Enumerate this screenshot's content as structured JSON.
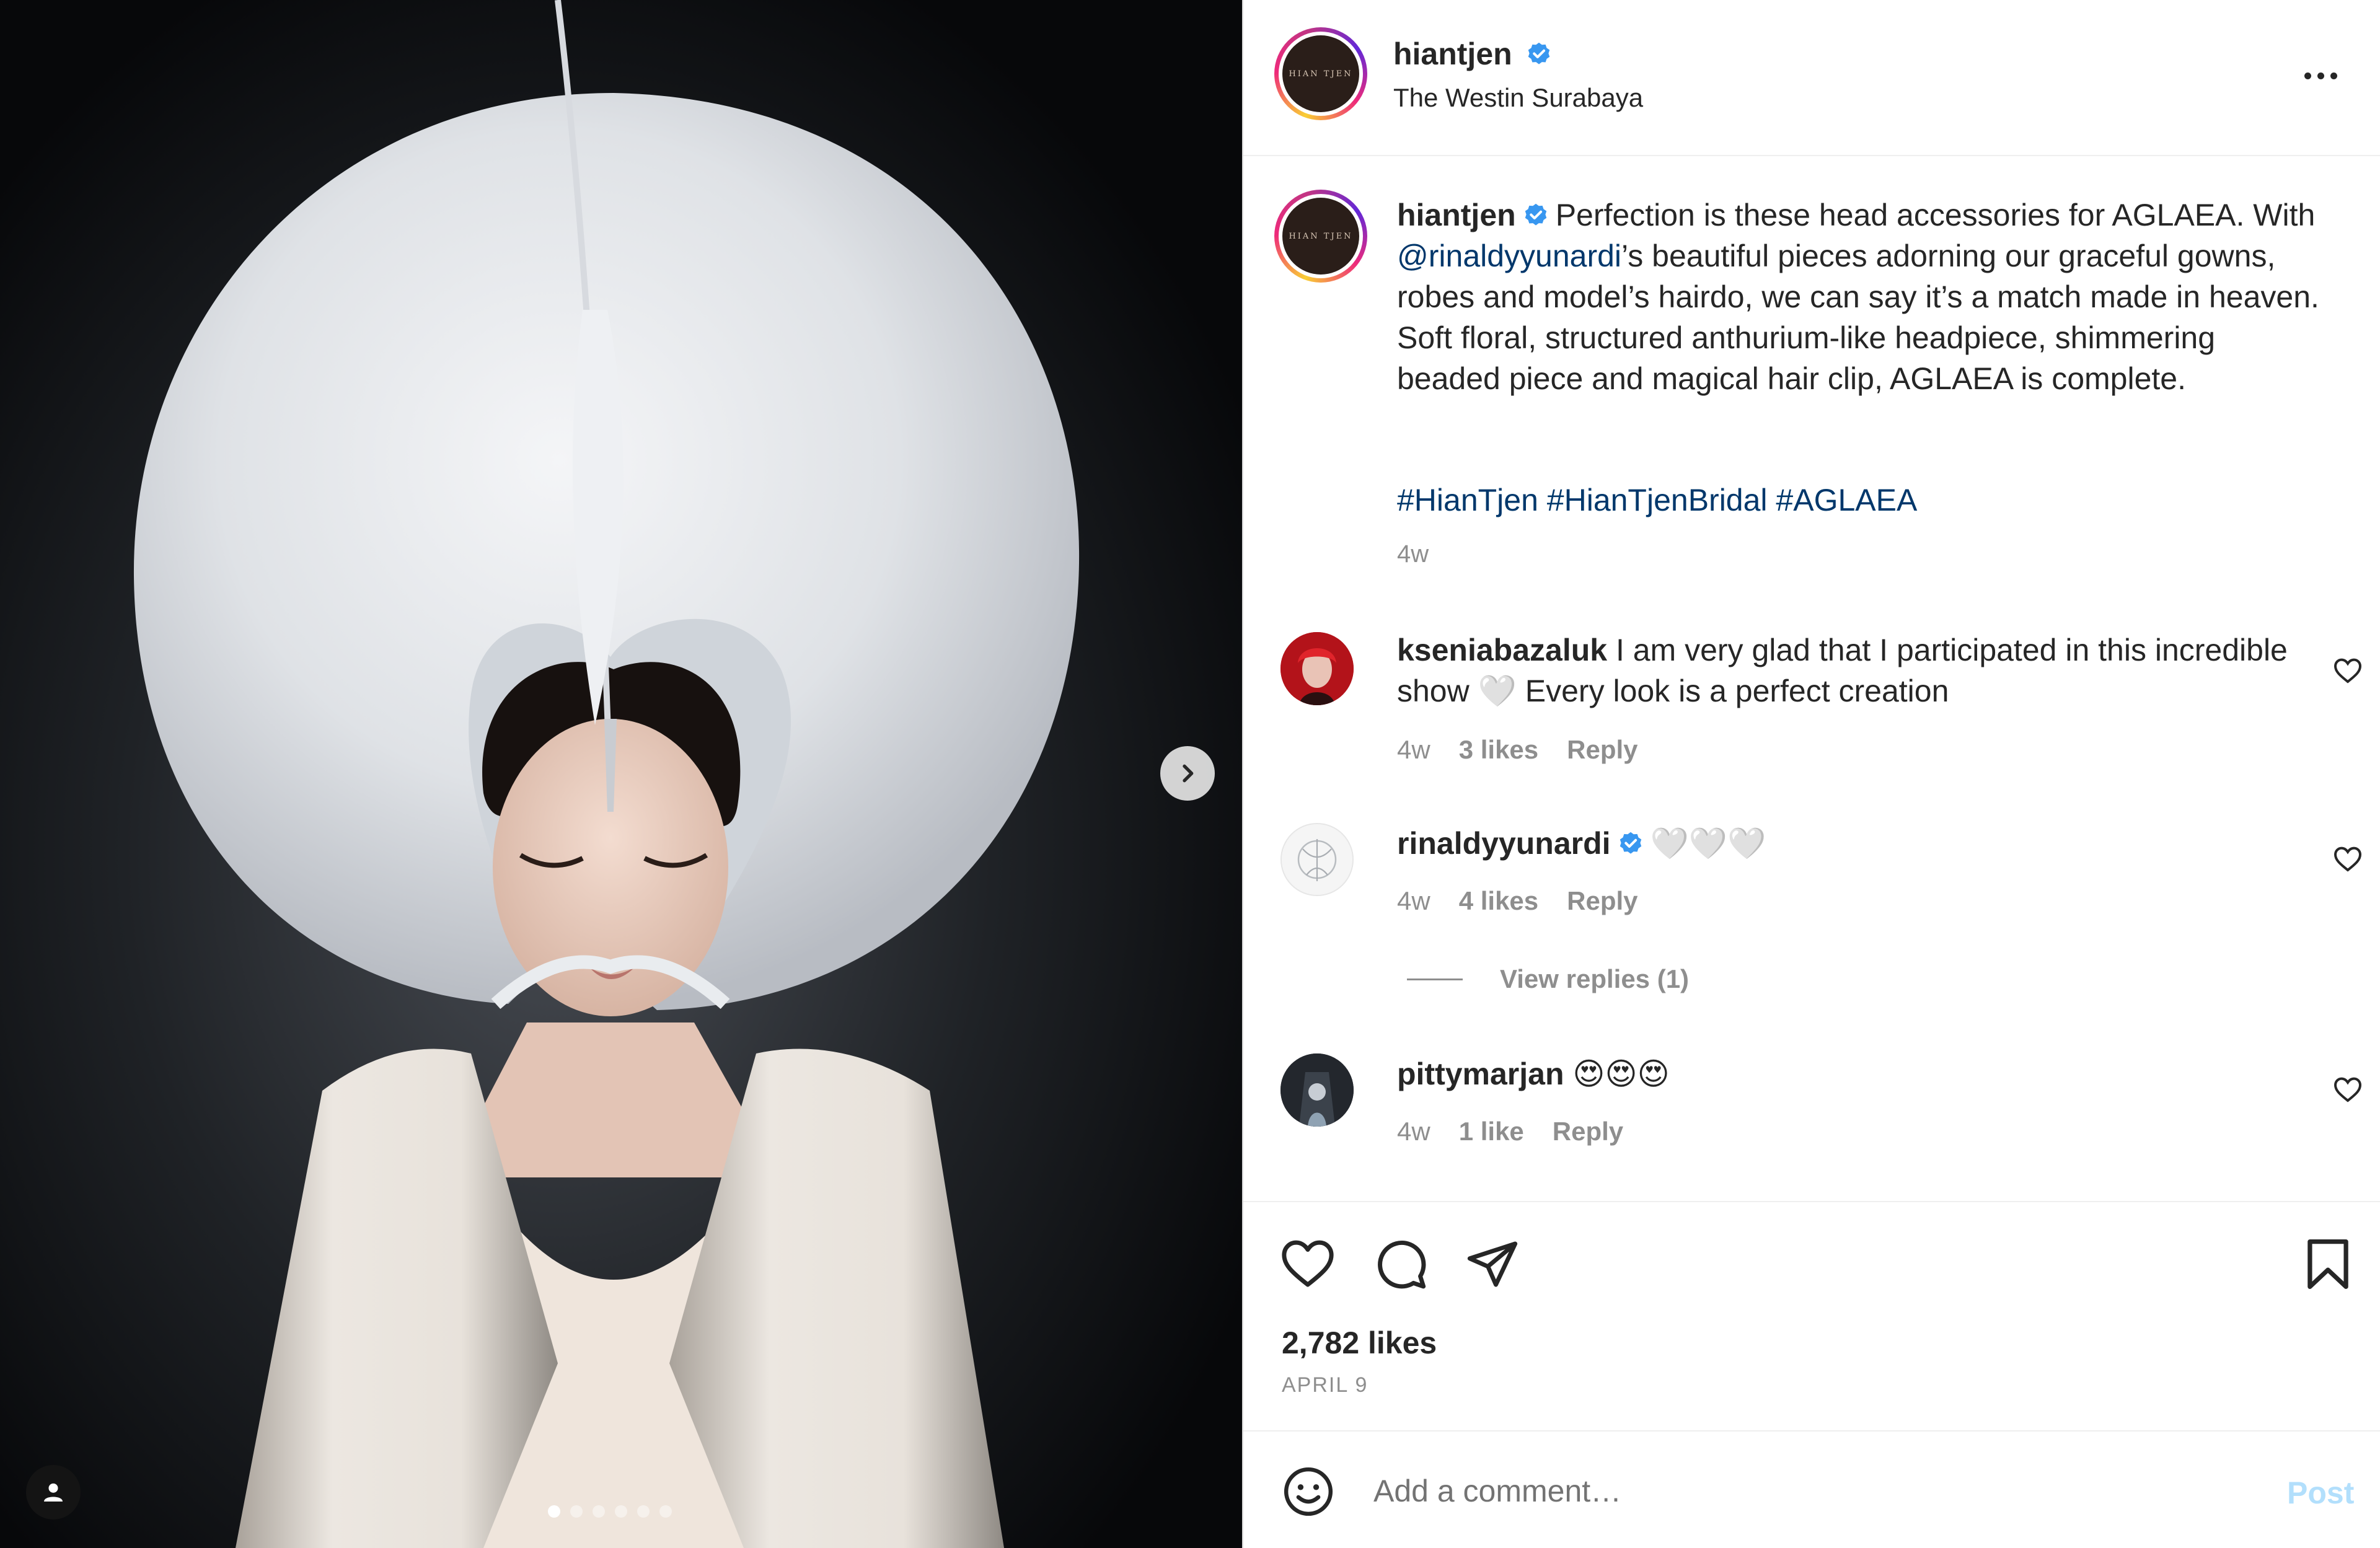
{
  "post": {
    "username": "hiantjen",
    "location": "The Westin Surabaya",
    "avatar_logo_text": "HIAN TJEN",
    "verified_icon": "verified-badge-icon",
    "more_icon": "more-options-icon"
  },
  "media": {
    "next_icon": "chevron-right-icon",
    "user_tag_icon": "user-icon",
    "slide_count": 6,
    "active_slide": 1
  },
  "caption": {
    "username": "hiantjen",
    "text_before_mention": "Perfection is these head accessories for AGLAEA. With ",
    "mention": "@rinaldyyunardi",
    "text_after_mention": "’s beautiful pieces adorning our graceful gowns, robes and model’s hairdo, we can say it’s a match made in heaven. Soft floral, structured anthurium-like headpiece, shimmering beaded piece and magical hair clip, AGLAEA is complete.",
    "hashtags": "#HianTjen #HianTjenBridal #AGLAEA",
    "time": "4w"
  },
  "comments": [
    {
      "username": "kseniabazaluk",
      "text": "I am very glad that I participated in this incredible show 🤍 Every look is a perfect creation",
      "time": "4w",
      "likes": "3 likes",
      "reply": "Reply"
    },
    {
      "username": "rinaldyyunardi",
      "verified": true,
      "text": "🤍🤍🤍",
      "time": "4w",
      "likes": "4 likes",
      "reply": "Reply",
      "view_replies": "View replies (1)"
    },
    {
      "username": "pittymarjan",
      "text": "😍😍😍",
      "time": "4w",
      "likes": "1 like",
      "reply": "Reply"
    }
  ],
  "actions": {
    "like_icon": "heart-icon",
    "comment_icon": "comment-icon",
    "share_icon": "send-icon",
    "save_icon": "bookmark-icon",
    "likes_count": "2,782 likes",
    "date": "APRIL 9"
  },
  "comment_box": {
    "emoji_icon": "emoji-icon",
    "placeholder": "Add a comment…",
    "post_label": "Post",
    "post_color": "#b2dffc"
  },
  "colors": {
    "link": "#00376b",
    "secondary": "#8e8e8e",
    "verified": "#3897f0"
  }
}
